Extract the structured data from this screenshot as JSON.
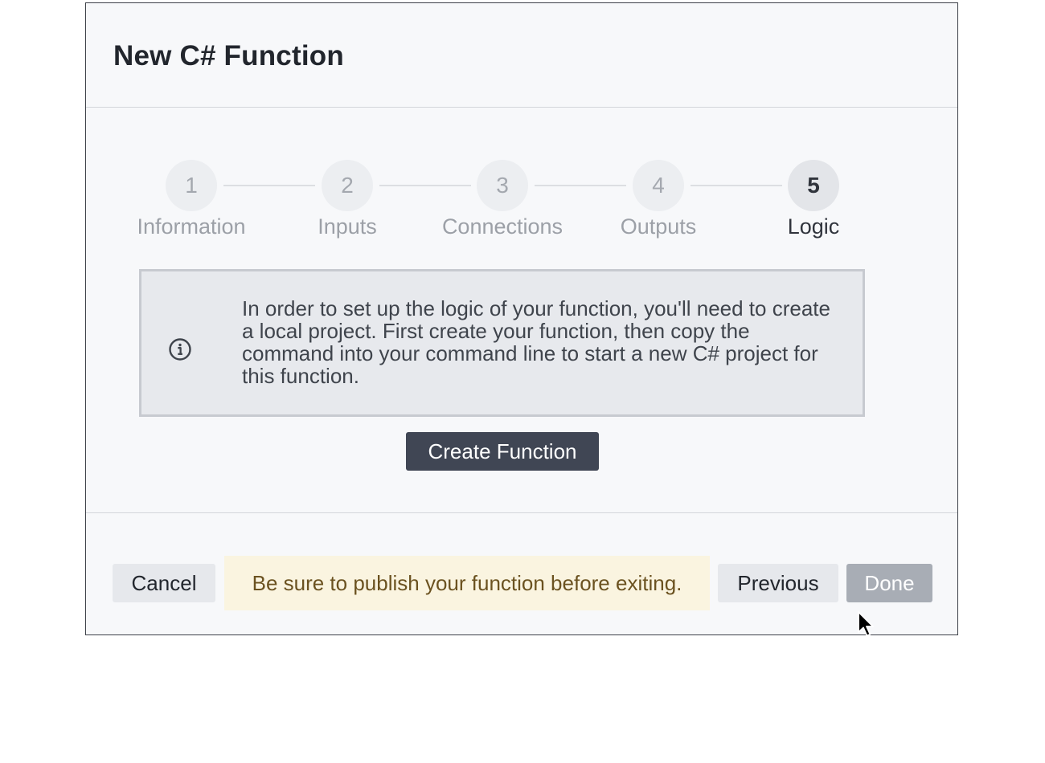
{
  "dialog": {
    "title": "New C# Function"
  },
  "stepper": {
    "current_step": 5,
    "steps": [
      {
        "number": "1",
        "label": "Information"
      },
      {
        "number": "2",
        "label": "Inputs"
      },
      {
        "number": "3",
        "label": "Connections"
      },
      {
        "number": "4",
        "label": "Outputs"
      },
      {
        "number": "5",
        "label": "Logic"
      }
    ]
  },
  "info": {
    "icon": "info-circle-icon",
    "text": "In order to set up the logic of your function, you'll need to create a local project. First create your function, then copy the command into your command line to start a new C# project for this function."
  },
  "actions": {
    "create_label": "Create Function"
  },
  "footer": {
    "cancel_label": "Cancel",
    "warning_text": "Be sure to publish your function before exiting.",
    "previous_label": "Previous",
    "done_label": "Done"
  },
  "colors": {
    "primary_button": "#404654",
    "disabled_button": "#a8adb5",
    "warning_background": "#faf4e0",
    "warning_text": "#6b5220"
  }
}
